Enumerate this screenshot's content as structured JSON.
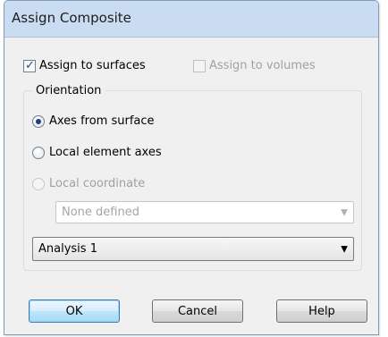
{
  "dialog": {
    "title": "Assign Composite"
  },
  "assign": {
    "surfaces_label": "Assign to surfaces",
    "surfaces_checked": true,
    "volumes_label": "Assign to volumes",
    "volumes_checked": false,
    "volumes_enabled": false
  },
  "orientation": {
    "legend": "Orientation",
    "options": [
      {
        "label": "Axes from surface",
        "selected": true,
        "enabled": true
      },
      {
        "label": "Local element axes",
        "selected": false,
        "enabled": true
      },
      {
        "label": "Local coordinate",
        "selected": false,
        "enabled": false
      }
    ],
    "coordinate_select": {
      "value": "None defined",
      "enabled": false
    },
    "analysis_select": {
      "value": "Analysis 1",
      "enabled": true
    }
  },
  "buttons": {
    "ok": "OK",
    "cancel": "Cancel",
    "help": "Help"
  },
  "icons": {
    "check": "checkmark-icon",
    "dropdown": "chevron-down-icon"
  },
  "colors": {
    "titlebar": "#c9dcf2",
    "dialog_bg": "#f0f0f0",
    "default_button": "#bde6fd"
  }
}
